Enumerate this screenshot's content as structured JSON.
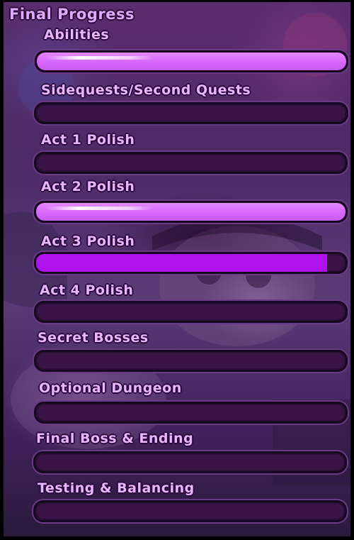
{
  "title": "Final Progress",
  "colors": {
    "label": "#e7b6ff",
    "bar_track": "#3a1446",
    "bar_fill_partial": "#b012ee",
    "bar_fill_complete": "#d667fa"
  },
  "items": [
    {
      "label": "Abilities",
      "progress": 1.0
    },
    {
      "label": "Sidequests/Second Quests",
      "progress": 0.0
    },
    {
      "label": "Act 1 Polish",
      "progress": 0.0
    },
    {
      "label": "Act 2 Polish",
      "progress": 1.0
    },
    {
      "label": "Act 3 Polish",
      "progress": 0.94
    },
    {
      "label": "Act 4 Polish",
      "progress": 0.0
    },
    {
      "label": "Secret Bosses",
      "progress": 0.0
    },
    {
      "label": "Optional Dungeon",
      "progress": 0.0
    },
    {
      "label": "Final Boss & Ending",
      "progress": 0.0
    },
    {
      "label": "Testing & Balancing",
      "progress": 0.0
    }
  ]
}
